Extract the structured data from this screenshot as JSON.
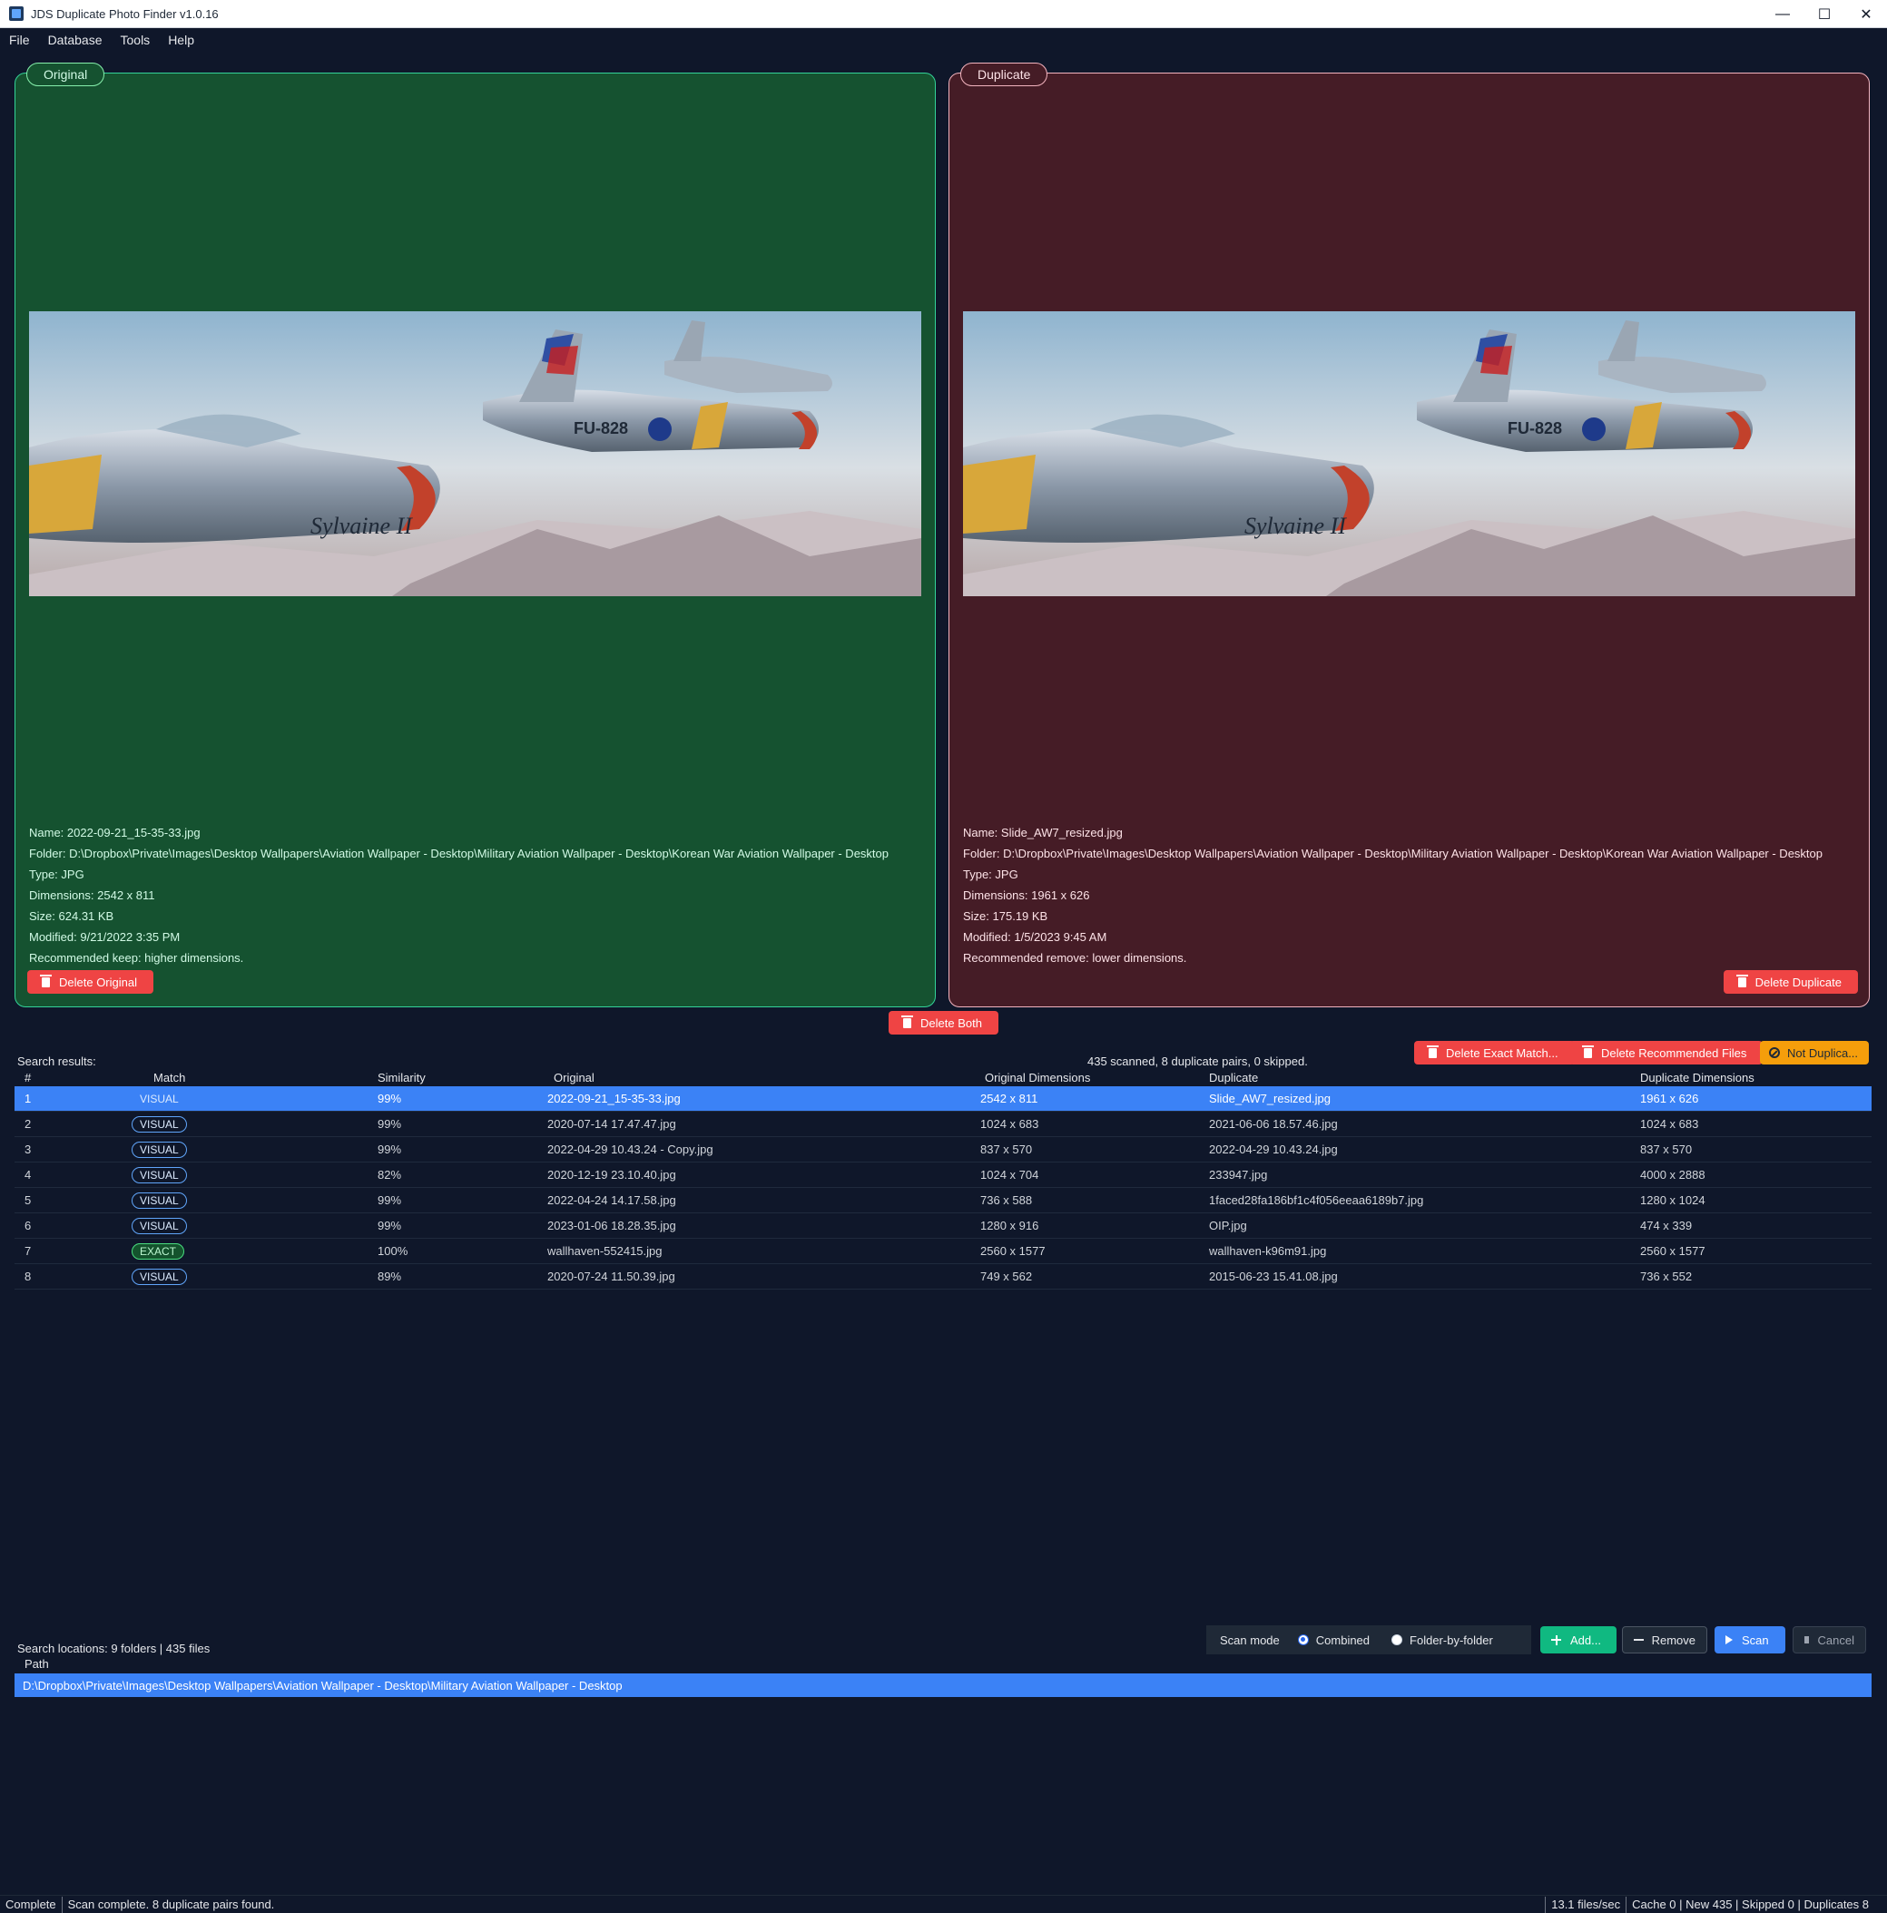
{
  "window": {
    "title": "JDS Duplicate Photo Finder v1.0.16",
    "controls": [
      "—",
      "☐",
      "✕"
    ]
  },
  "menu": [
    "File",
    "Database",
    "Tools",
    "Help"
  ],
  "original_panel": {
    "tab": "Original",
    "name": "Name: 2022-09-21_15-35-33.jpg",
    "folder": "Folder: D:\\Dropbox\\Private\\Images\\Desktop Wallpapers\\Aviation Wallpaper - Desktop\\Military Aviation Wallpaper - Desktop\\Korean War Aviation Wallpaper - Desktop",
    "type": "Type: JPG",
    "dimensions": "Dimensions: 2542 x 811",
    "size": "Size: 624.31 KB",
    "modified": "Modified: 9/21/2022 3:35 PM",
    "recommendation": "Recommended keep: higher dimensions.",
    "delete_label": "Delete Original",
    "color": "#155230"
  },
  "duplicate_panel": {
    "tab": "Duplicate",
    "name": "Name: Slide_AW7_resized.jpg",
    "folder": "Folder: D:\\Dropbox\\Private\\Images\\Desktop Wallpapers\\Aviation Wallpaper - Desktop\\Military Aviation Wallpaper - Desktop\\Korean War Aviation Wallpaper - Desktop",
    "type": "Type: JPG",
    "dimensions": "Dimensions: 1961 x 626",
    "size": "Size: 175.19 KB",
    "modified": "Modified: 1/5/2023 9:45 AM",
    "recommendation": "Recommended remove: lower dimensions.",
    "delete_label": "Delete Duplicate",
    "color": "#451c26"
  },
  "delete_both_label": "Delete Both",
  "results": {
    "label": "Search results:",
    "summary": "435 scanned, 8 duplicate pairs, 0 skipped.",
    "actions": {
      "delete_exact": "Delete Exact Match...",
      "delete_recommended": "Delete Recommended Files",
      "not_duplicate": "Not Duplica..."
    },
    "columns": [
      "#",
      "Match",
      "Similarity",
      "Original",
      "Original Dimensions",
      "Duplicate",
      "Duplicate Dimensions"
    ],
    "rows": [
      {
        "n": "1",
        "match": "VISUAL",
        "similarity": "99%",
        "original": "2022-09-21_15-35-33.jpg",
        "orig_dim": "2542 x 811",
        "duplicate": "Slide_AW7_resized.jpg",
        "dup_dim": "1961 x 626"
      },
      {
        "n": "2",
        "match": "VISUAL",
        "similarity": "99%",
        "original": "2020-07-14 17.47.47.jpg",
        "orig_dim": "1024 x 683",
        "duplicate": "2021-06-06 18.57.46.jpg",
        "dup_dim": "1024 x 683"
      },
      {
        "n": "3",
        "match": "VISUAL",
        "similarity": "99%",
        "original": "2022-04-29 10.43.24 - Copy.jpg",
        "orig_dim": "837 x 570",
        "duplicate": "2022-04-29 10.43.24.jpg",
        "dup_dim": "837 x 570"
      },
      {
        "n": "4",
        "match": "VISUAL",
        "similarity": "82%",
        "original": "2020-12-19 23.10.40.jpg",
        "orig_dim": "1024 x 704",
        "duplicate": "233947.jpg",
        "dup_dim": "4000 x 2888"
      },
      {
        "n": "5",
        "match": "VISUAL",
        "similarity": "99%",
        "original": "2022-04-24 14.17.58.jpg",
        "orig_dim": "736 x 588",
        "duplicate": "1faced28fa186bf1c4f056eeaa6189b7.jpg",
        "dup_dim": "1280 x 1024"
      },
      {
        "n": "6",
        "match": "VISUAL",
        "similarity": "99%",
        "original": "2023-01-06 18.28.35.jpg",
        "orig_dim": "1280 x 916",
        "duplicate": "OIP.jpg",
        "dup_dim": "474 x 339"
      },
      {
        "n": "7",
        "match": "EXACT",
        "similarity": "100%",
        "original": "wallhaven-552415.jpg",
        "orig_dim": "2560 x 1577",
        "duplicate": "wallhaven-k96m91.jpg",
        "dup_dim": "2560 x 1577"
      },
      {
        "n": "8",
        "match": "VISUAL",
        "similarity": "89%",
        "original": "2020-07-24 11.50.39.jpg",
        "orig_dim": "749 x 562",
        "duplicate": "2015-06-23 15.41.08.jpg",
        "dup_dim": "736 x 552"
      }
    ]
  },
  "scan": {
    "mode_label": "Scan mode",
    "options": [
      "Combined",
      "Folder-by-folder"
    ],
    "selected": "Combined",
    "add": "Add...",
    "remove": "Remove",
    "scan": "Scan",
    "cancel": "Cancel"
  },
  "locations": {
    "label": "Search locations: 9 folders | 435 files",
    "column": "Path",
    "paths": [
      "D:\\Dropbox\\Private\\Images\\Desktop Wallpapers\\Aviation Wallpaper - Desktop\\Military Aviation Wallpaper - Desktop"
    ]
  },
  "status": {
    "state": "Complete",
    "message": "Scan complete. 8 duplicate pairs found.",
    "rate": "13.1 files/sec",
    "counts": "Cache 0 | New 435 | Skipped 0 | Duplicates 8"
  },
  "colors": {
    "accent": "#3b82f6",
    "danger": "#ef4444",
    "success": "#10b981",
    "warning": "#f59e0b"
  }
}
